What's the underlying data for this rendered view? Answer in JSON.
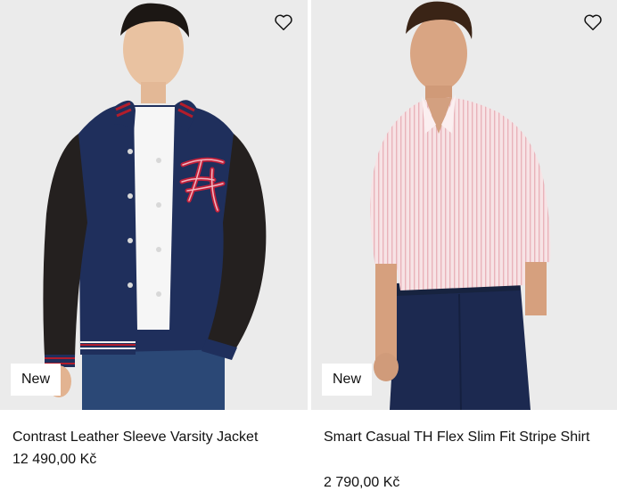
{
  "products": [
    {
      "badge": "New",
      "name": "Contrast Leather Sleeve Varsity Jacket",
      "price": "12 490,00 Kč",
      "wishlist_icon": "heart-outline-icon",
      "colors": {
        "jacket_body": "#1f2f5c",
        "sleeves": "#24201f",
        "stripe_red": "#b21d2b",
        "monogram": "#c2203a"
      }
    },
    {
      "badge": "New",
      "name": "Smart Casual TH Flex Slim Fit Stripe Shirt",
      "price": "2 790,00 Kč",
      "wishlist_icon": "heart-outline-icon",
      "colors": {
        "shirt": "#f4d9dc",
        "trousers": "#1c2950"
      }
    }
  ]
}
